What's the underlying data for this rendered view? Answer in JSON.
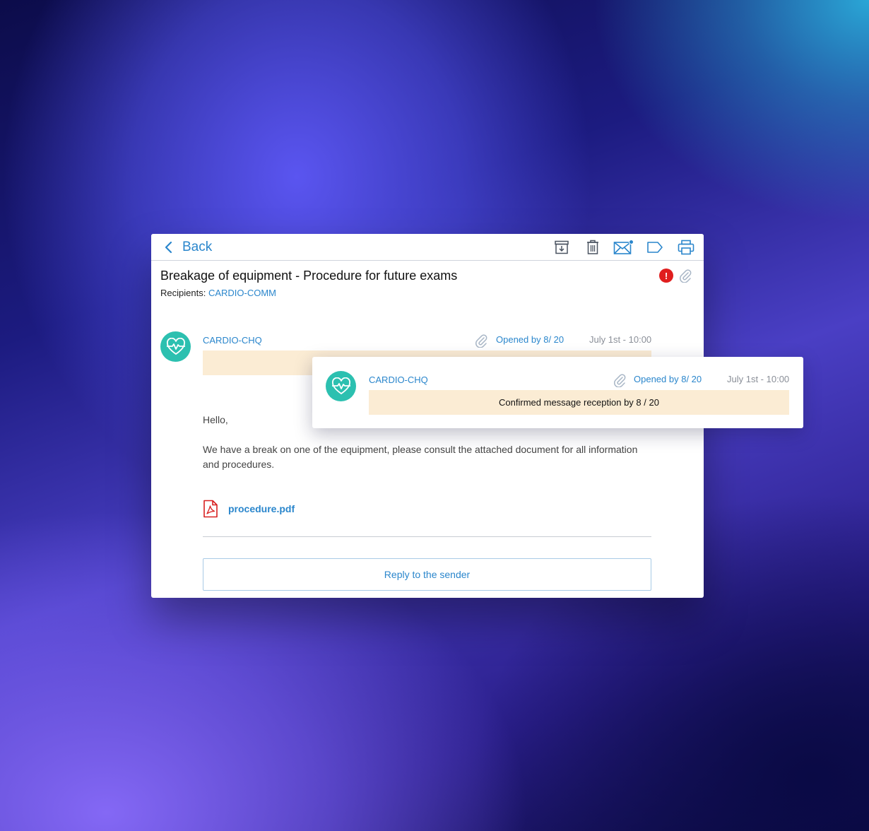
{
  "toolbar": {
    "back_label": "Back",
    "icons": [
      "archive-icon",
      "trash-icon",
      "mail-unread-icon",
      "tag-icon",
      "printer-icon"
    ]
  },
  "message": {
    "subject": "Breakage of equipment - Procedure for future exams",
    "recipients_label": "Recipients:",
    "recipients_value": "CARDIO-COMM",
    "sender": "CARDIO-CHQ",
    "opened": "Opened by 8/ 20",
    "date": "July 1st - 10:00",
    "greeting": "Hello,",
    "body": "We have a break on one of the equipment, please consult the attached document for all information and procedures.",
    "attachment_name": "procedure.pdf",
    "reply_label": "Reply to the sender"
  },
  "popup": {
    "sender": "CARDIO-CHQ",
    "opened": "Opened by 8/ 20",
    "date": "July 1st - 10:00",
    "confirmation": "Confirmed message reception by 8 / 20"
  },
  "colors": {
    "accent": "#2a86cc",
    "avatar": "#2cc0b0",
    "alert": "#e01e1e",
    "highlight": "#fbecd4"
  }
}
